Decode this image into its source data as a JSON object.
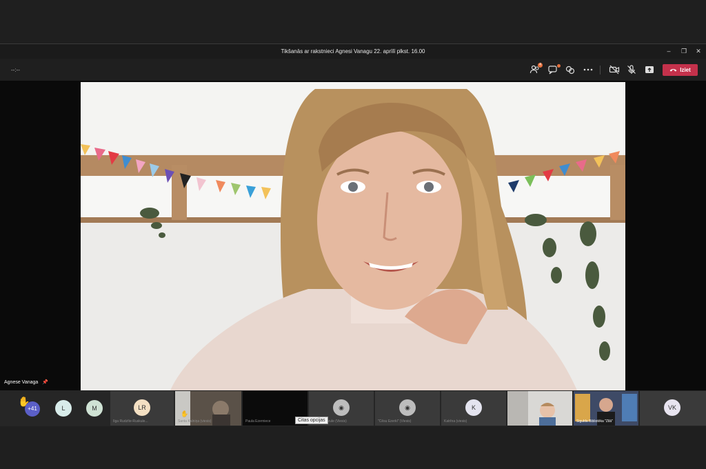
{
  "window": {
    "title": "Tikšanās ar rakstnieci Agnesi Vanagu 22. aprīlī plkst. 16.00",
    "controls": [
      "minimize",
      "restore",
      "close"
    ]
  },
  "toolbar": {
    "timer": "--:--",
    "participants_badge": "4",
    "leave_label": "Iziet"
  },
  "stage": {
    "speaker_name": "Agnese Vanaga"
  },
  "strip": {
    "raised_count": "+41",
    "avatars": [
      {
        "initials": "L",
        "color": "#d8ecea"
      },
      {
        "initials": "M",
        "color": "#cfe2d4"
      },
      {
        "initials": "LR",
        "color": "#f4e0c3"
      }
    ],
    "tiles": [
      {
        "name": "Ilga Rudzīte-Ruskule..."
      },
      {
        "name": "Santa Kalniņa (viesis)"
      },
      {
        "name": "Paula Ezerniece"
      },
      {
        "name": "Sandra Ķuzule (Viesis)"
      },
      {
        "name": "\"Cēsu Ezerkl\" (Viesis)"
      },
      {
        "initials": "K",
        "name": "Katrīna (viesis)"
      },
      {
        "name": ""
      },
      {
        "name": "Sigulda Bibliotēka \"Zilā\""
      },
      {
        "initials": "VK",
        "name": ""
      }
    ],
    "tooltip": "Citas opcijas"
  },
  "colors": {
    "accent": "#c4314b",
    "badge": "#e5713d",
    "background": "#1f1f1f"
  }
}
